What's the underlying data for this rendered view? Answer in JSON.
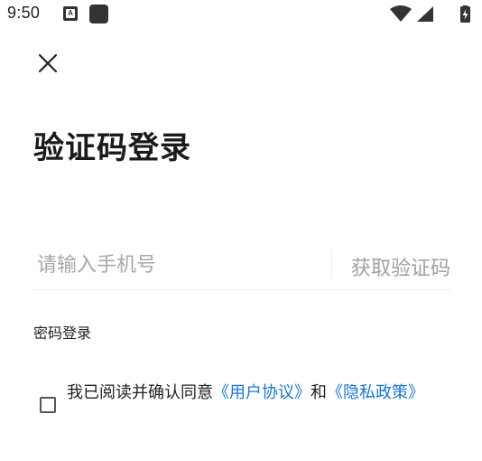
{
  "status_bar": {
    "time": "9:50",
    "notification_icon_letter": "A",
    "icons": [
      "a-notification-icon",
      "app-square-icon",
      "wifi-icon",
      "signal-icon",
      "battery-charging-icon"
    ]
  },
  "header": {
    "close_icon": "close-icon"
  },
  "main": {
    "title": "验证码登录",
    "phone_input": {
      "value": "",
      "placeholder": "请输入手机号"
    },
    "get_code_label": "获取验证码",
    "password_login_label": "密码登录"
  },
  "agreement": {
    "checked": false,
    "prefix": "我已阅读并确认同意",
    "user_agreement_link": "《用户协议》",
    "conjunction": "和",
    "privacy_policy_link": "《隐私政策》"
  },
  "colors": {
    "link": "#1677d8",
    "placeholder": "#a8a8a8",
    "divider": "#eeeeee",
    "text": "#222222"
  }
}
